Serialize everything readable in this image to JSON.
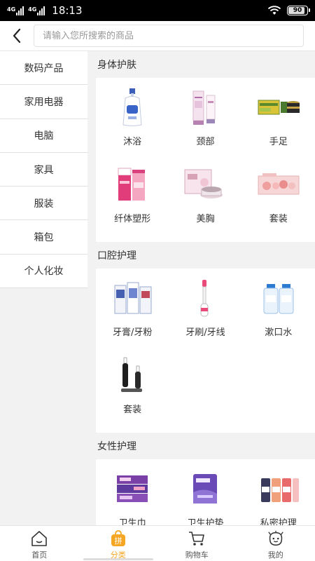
{
  "status_bar": {
    "network1": "4G",
    "network2": "4G",
    "time": "18:13",
    "battery": "90",
    "battery_level": 0.9,
    "icons": [
      "signal-icon",
      "wifi-icon",
      "battery-icon"
    ]
  },
  "header": {
    "back_icon": "chevron-left-icon",
    "search_placeholder": "请输入您所搜索的商品"
  },
  "sidebar": {
    "items": [
      {
        "label": "数码产品"
      },
      {
        "label": "家用电器"
      },
      {
        "label": "电脑"
      },
      {
        "label": "家具"
      },
      {
        "label": "服装"
      },
      {
        "label": "箱包"
      },
      {
        "label": "个人化妆"
      }
    ]
  },
  "sections": [
    {
      "title": "身体护肤",
      "items": [
        {
          "label": "沐浴",
          "icon": "body-wash-bottle-icon"
        },
        {
          "label": "颈部",
          "icon": "neck-cream-tube-icon"
        },
        {
          "label": "手足",
          "icon": "hand-foot-cream-icon"
        },
        {
          "label": "纤体塑形",
          "icon": "slimming-cream-icon"
        },
        {
          "label": "美胸",
          "icon": "bust-cream-box-icon"
        },
        {
          "label": "套装",
          "icon": "skincare-set-icon"
        }
      ]
    },
    {
      "title": "口腔护理",
      "items": [
        {
          "label": "牙膏/牙粉",
          "icon": "toothpaste-icon"
        },
        {
          "label": "牙刷/牙线",
          "icon": "toothbrush-icon"
        },
        {
          "label": "漱口水",
          "icon": "mouthwash-icon"
        },
        {
          "label": "套装",
          "icon": "electric-toothbrush-set-icon"
        }
      ]
    },
    {
      "title": "女性护理",
      "items": [
        {
          "label": "卫生巾",
          "icon": "sanitary-napkin-icon"
        },
        {
          "label": "卫生护垫",
          "icon": "panty-liner-icon"
        },
        {
          "label": "私密护理",
          "icon": "intimate-care-bottles-icon"
        }
      ]
    }
  ],
  "tabbar": {
    "active_color": "#f5a623",
    "tabs": [
      {
        "label": "首页",
        "icon": "home-icon"
      },
      {
        "label": "分类",
        "icon": "category-bag-icon",
        "badge": "拼"
      },
      {
        "label": "购物车",
        "icon": "cart-icon"
      },
      {
        "label": "我的",
        "icon": "profile-icon"
      }
    ]
  }
}
